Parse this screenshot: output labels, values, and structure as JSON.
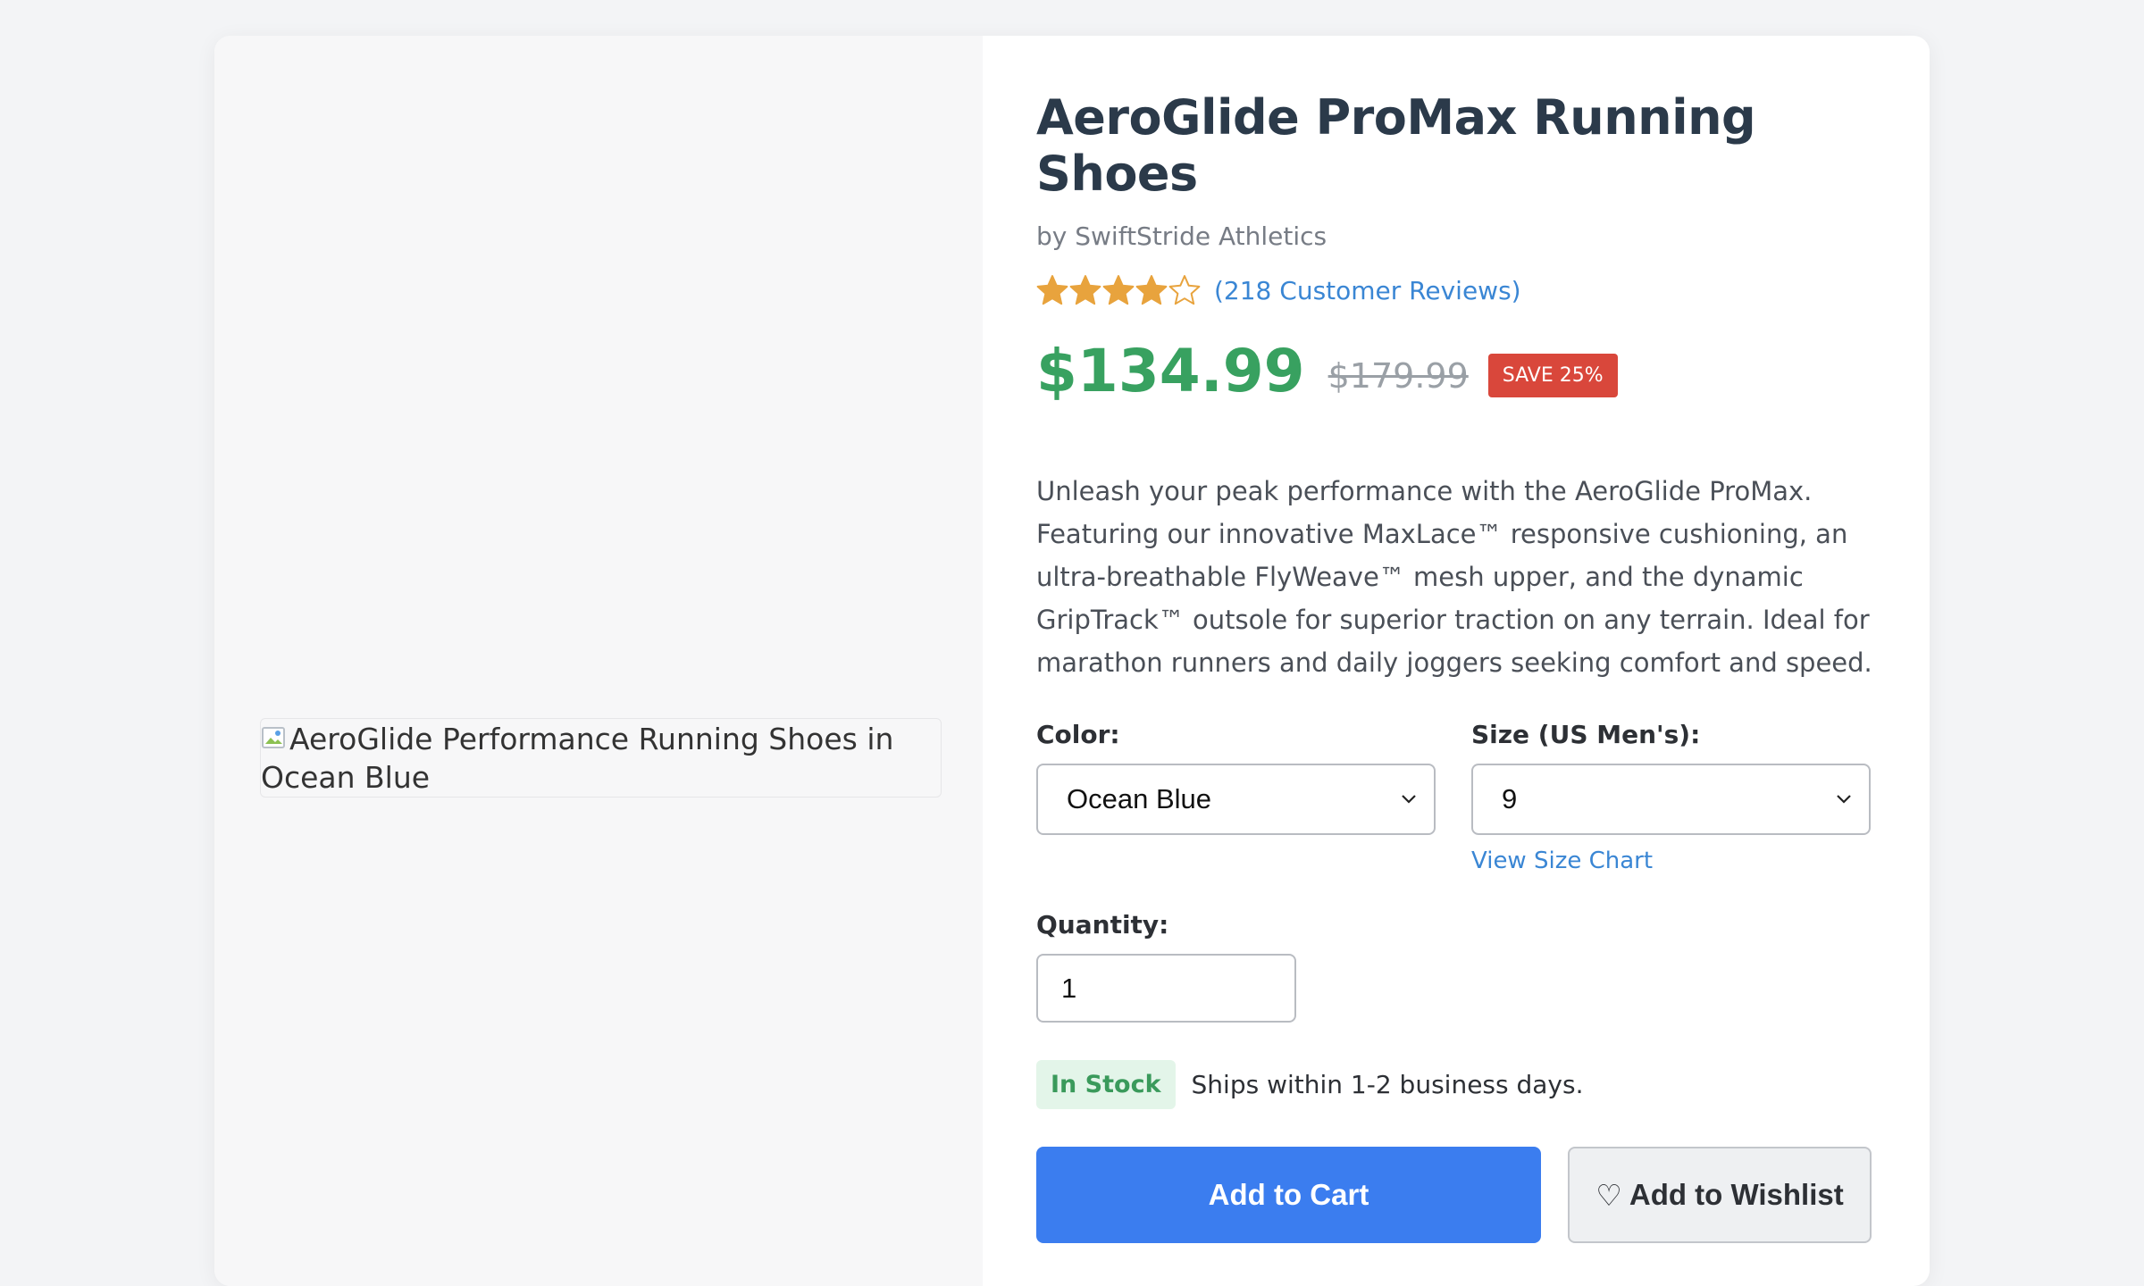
{
  "product": {
    "title": "AeroGlide ProMax Running Shoes",
    "brand": "by SwiftStride Athletics",
    "image_alt": "AeroGlide Performance Running Shoes in Ocean Blue",
    "rating_stars": 4,
    "rating_max": 5,
    "reviews_link": "(218 Customer Reviews)",
    "price": "$134.99",
    "original_price": "$179.99",
    "discount_badge": "SAVE 25%",
    "description": "Unleash your peak performance with the AeroGlide ProMax. Featuring our innovative MaxLace™ responsive cushioning, an ultra-breathable FlyWeave™ mesh upper, and the dynamic GripTrack™ outsole for superior traction on any terrain. Ideal for marathon runners and daily joggers seeking comfort and speed."
  },
  "options": {
    "color_label": "Color:",
    "color_value": "Ocean Blue",
    "size_label": "Size (US Men's):",
    "size_value": "9",
    "size_chart_link": "View Size Chart",
    "quantity_label": "Quantity:",
    "quantity_value": "1"
  },
  "stock": {
    "badge": "In Stock",
    "shipping": "Ships within 1-2 business days."
  },
  "actions": {
    "add_to_cart": "Add to Cart",
    "wishlist_icon": "♡",
    "add_to_wishlist": "Add to Wishlist"
  },
  "colors": {
    "price_green": "#38a160",
    "accent_blue": "#3b7def",
    "link_blue": "#3a86d4",
    "sale_red": "#d9473b",
    "star_gold": "#e8a33d"
  },
  "icons": {
    "star_full": "star-filled-icon",
    "star_empty": "star-outline-icon",
    "dropdown": "chevron-down-icon",
    "broken_image": "broken-image-icon",
    "wishlist": "heart-icon"
  }
}
